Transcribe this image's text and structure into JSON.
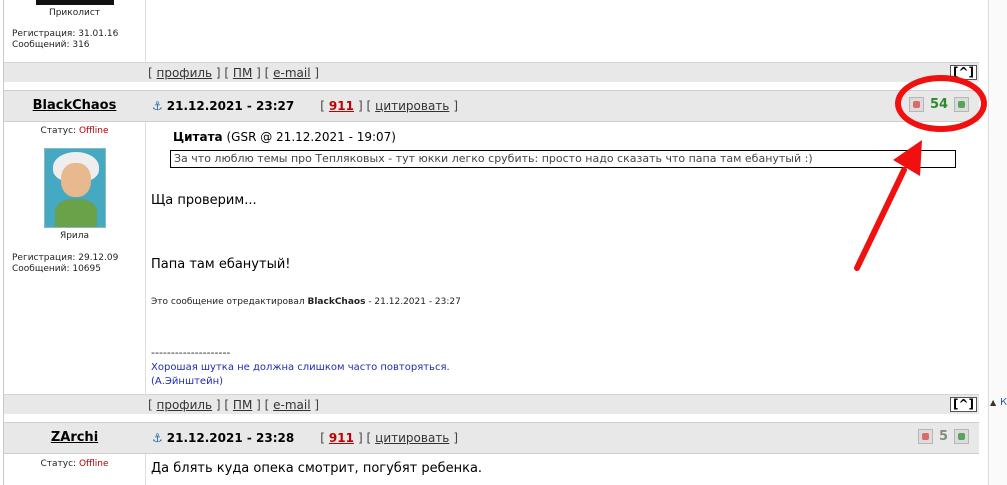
{
  "post_prev": {
    "user_title": "Приколист",
    "registered": "Регистрация: 31.01.16",
    "messages": "Сообщений: 316",
    "footer": {
      "profile": "профиль",
      "pm": "ПМ",
      "email": "e-mail",
      "up": "[^]"
    }
  },
  "post_main": {
    "username": "BlackChaos",
    "datetime": "21.12.2021 - 23:27",
    "post_number": "911",
    "quote_label": "цитировать",
    "status_label": "Статус:",
    "status_value": "Offline",
    "user_title": "Ярила",
    "registered": "Регистрация: 29.12.09",
    "messages": "Сообщений: 10695",
    "rating": "54",
    "quote_title": "Цитата",
    "quote_meta": "(GSR @ 21.12.2021 - 19:07)",
    "quote_text": "За что люблю темы про Тепляковых -  тут юкки легко срубить: просто надо сказать что папа там ебанутый :)",
    "body_line1": "Ща проверим...",
    "body_line2": "Папа там ебанутый!",
    "edited_prefix": "Это сообщение отредактировал",
    "edited_user": "BlackChaos",
    "edited_suffix": "- 21.12.2021 - 23:27",
    "sig_separator": "--------------------",
    "sig_line1": "Хорошая шутка не должна слишком часто повторяться.",
    "sig_line2": "(А.Эйнштейн)",
    "footer": {
      "profile": "профиль",
      "pm": "ПМ",
      "email": "e-mail",
      "up": "[^]"
    }
  },
  "post_next": {
    "username": "ZArchi",
    "datetime": "21.12.2021 - 23:28",
    "post_number": "911",
    "quote_label": "цитировать",
    "status_label": "Статус:",
    "status_value": "Offline",
    "rating": "5",
    "body_line1": "Да блять куда опека смотрит, погубят ребенка."
  },
  "side_scroll": {
    "arrow": "▲",
    "text": "К"
  },
  "colors": {
    "annotation": "#f01010",
    "rating_positive": "#2d8a2d",
    "offline": "#c00000"
  }
}
